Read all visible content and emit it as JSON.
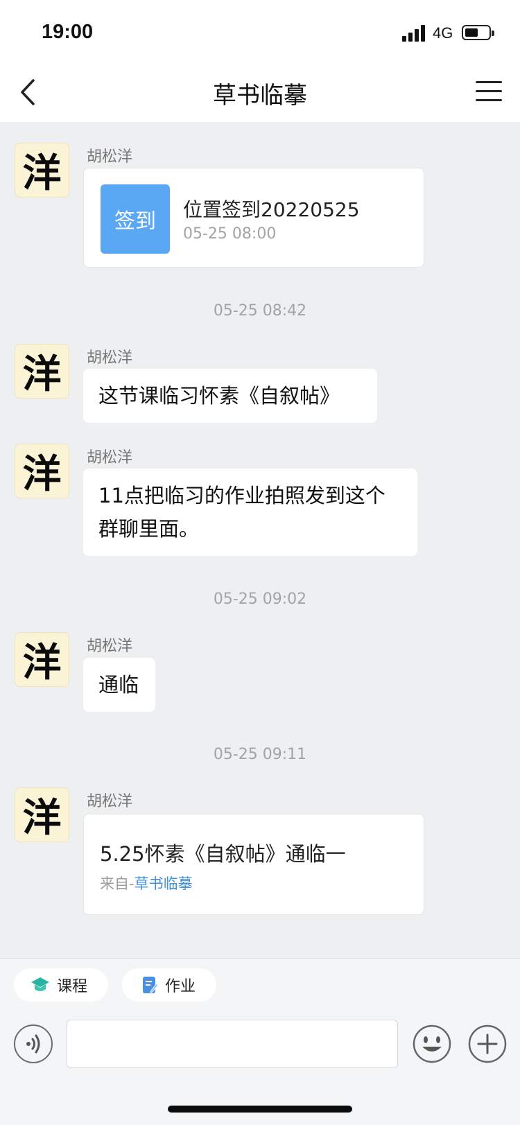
{
  "status_bar": {
    "time": "19:00",
    "network": "4G"
  },
  "nav": {
    "title": "草书临摹",
    "back_icon": "chevron-left-icon",
    "menu_icon": "menu-icon"
  },
  "messages": [
    {
      "sender": "胡松洋",
      "avatar_char": "洋",
      "type": "checkin",
      "badge": "签到",
      "title": "位置签到20220525",
      "time": "05-25 08:00"
    },
    {
      "divider": "05-25 08:42"
    },
    {
      "sender": "胡松洋",
      "avatar_char": "洋",
      "text": "这节课临习怀素《自叙帖》"
    },
    {
      "sender": "胡松洋",
      "avatar_char": "洋",
      "text_line1": "11点把临习的作业拍照发到这个",
      "text_line2": "群聊里面。"
    },
    {
      "divider": "05-25 09:02"
    },
    {
      "sender": "胡松洋",
      "avatar_char": "洋",
      "text": "通临"
    },
    {
      "divider": "05-25 09:11"
    },
    {
      "sender": "胡松洋",
      "avatar_char": "洋",
      "type": "homework",
      "title": "5.25怀素《自叙帖》通临一",
      "source_prefix": "来自-",
      "source_link": "草书临摹"
    }
  ],
  "bottom": {
    "quick_actions": [
      {
        "label": "课程",
        "icon": "graduation-cap-icon",
        "color": "#29b3a0"
      },
      {
        "label": "作业",
        "icon": "notebook-pen-icon",
        "color": "#4a90e2"
      }
    ],
    "input_value": "",
    "voice_icon": "voice-icon",
    "emoji_icon": "smiley-icon",
    "plus_icon": "plus-icon"
  }
}
